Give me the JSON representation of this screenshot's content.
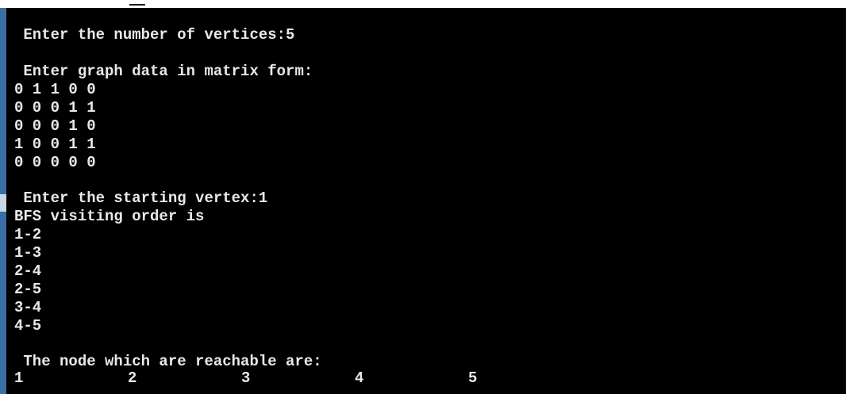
{
  "console": {
    "lines": [
      " Enter the number of vertices:5",
      "",
      " Enter graph data in matrix form:",
      "0 1 1 0 0",
      "0 0 0 1 1",
      "0 0 0 1 0",
      "1 0 0 1 1",
      "0 0 0 0 0",
      "",
      " Enter the starting vertex:1",
      "BFS visiting order is",
      "1-2",
      "1-3",
      "2-4",
      "2-5",
      "3-4",
      "4-5",
      "",
      " The node which are reachable are:"
    ],
    "reachable_nodes": [
      "1",
      "2",
      "3",
      "4",
      "5"
    ]
  },
  "colors": {
    "terminal_bg": "#000000",
    "terminal_text": "#e8e8e8",
    "left_edge": "#3a6ea5"
  }
}
